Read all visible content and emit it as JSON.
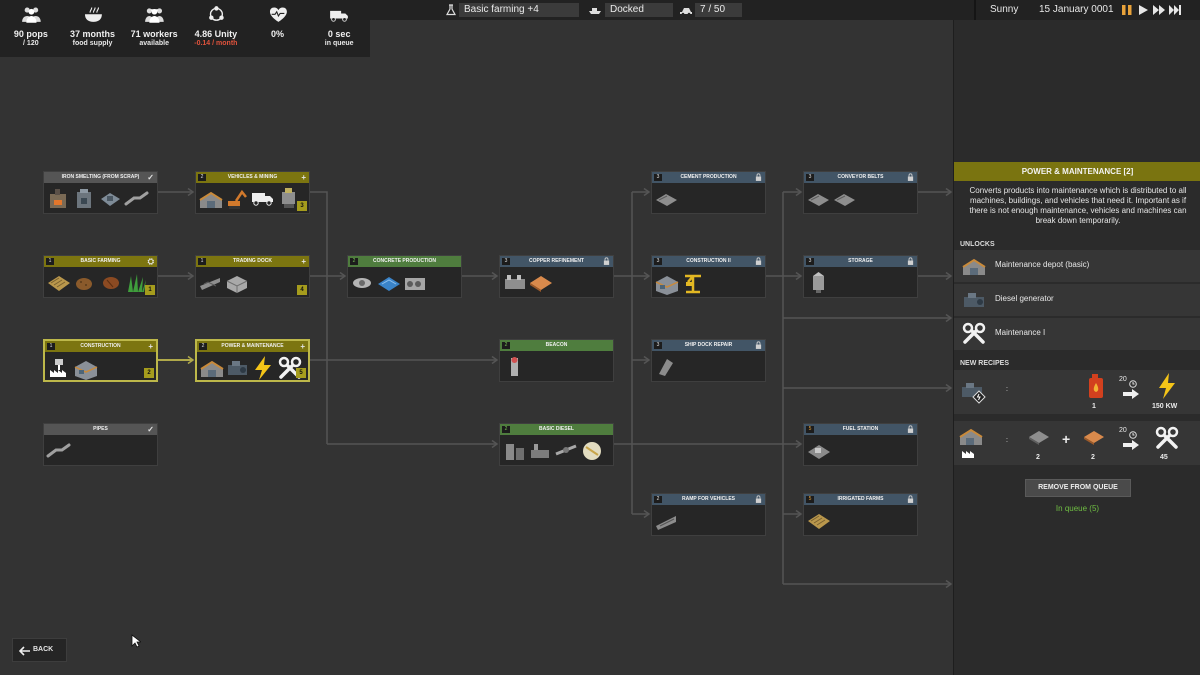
{
  "stats": [
    {
      "name": "pops",
      "icon": "people-icon",
      "value": "90 pops",
      "sub": "/ 120",
      "negative": false
    },
    {
      "name": "food",
      "icon": "bowl-icon",
      "value": "37 months",
      "sub": "food supply",
      "negative": false
    },
    {
      "name": "workers",
      "icon": "workers-icon",
      "value": "71 workers",
      "sub": "available",
      "negative": false
    },
    {
      "name": "unity",
      "icon": "unity-icon",
      "value": "4.86 Unity",
      "sub": "-0.14 / month",
      "negative": true
    },
    {
      "name": "health",
      "icon": "heart-icon",
      "value": "0%",
      "sub": "",
      "negative": false
    },
    {
      "name": "queue",
      "icon": "truck-icon",
      "value": "0 sec",
      "sub": "in queue",
      "negative": false
    }
  ],
  "topbar": {
    "research": "Basic farming +4",
    "ship_status": "Docked",
    "vehicles": "7 / 50",
    "weather": "Sunny",
    "date": "15 January 0001",
    "speed_controls": [
      "pause-icon",
      "play-icon",
      "fast-forward-icon",
      "fastest-icon"
    ]
  },
  "colors": {
    "header_yellow": "#7c7510",
    "header_green": "#4f7d3e",
    "header_blue": "#425566",
    "header_gray": "#555555",
    "queue_green": "#6fbf43",
    "negative_red": "#e0533c"
  },
  "tree": {
    "nodes": [
      {
        "id": "iron-smelting",
        "title": "IRON SMELTING (FROM SCRAP)",
        "tier": "",
        "color": "gray",
        "marker": "✓",
        "icons": [
          "furnace-icon",
          "smelter-icon",
          "machine-icon",
          "pipe-icon"
        ],
        "count": ""
      },
      {
        "id": "vehicles-mining",
        "title": "VEHICLES & MINING",
        "tier": "2",
        "color": "yellow",
        "marker": "+",
        "icons": [
          "depot-icon",
          "excavator-icon",
          "truck-icon",
          "robot-icon"
        ],
        "count": "3"
      },
      {
        "id": "basic-farming",
        "title": "BASIC FARMING",
        "tier": "1",
        "color": "yellow",
        "marker": "⛭",
        "icons": [
          "farm-field-icon",
          "potato-icon",
          "wheat-icon",
          "grass-icon"
        ],
        "count": "1"
      },
      {
        "id": "trading-dock",
        "title": "TRADING DOCK",
        "tier": "1",
        "color": "yellow",
        "marker": "+",
        "icons": [
          "dock-icon",
          "container-icon"
        ],
        "count": "4"
      },
      {
        "id": "construction",
        "title": "CONSTRUCTION",
        "tier": "1",
        "color": "yellow",
        "marker": "+",
        "icons": [
          "construction-hand-icon",
          "building-icon"
        ],
        "count": "2"
      },
      {
        "id": "power-maintenance",
        "title": "POWER & MAINTENANCE",
        "tier": "2",
        "color": "yellow",
        "marker": "+",
        "icons": [
          "depot-icon",
          "generator-icon",
          "lightning-icon",
          "wrench-icon"
        ],
        "count": "5"
      },
      {
        "id": "pipes",
        "title": "PIPES",
        "tier": "",
        "color": "gray",
        "marker": "✓",
        "icons": [
          "pipe-icon"
        ],
        "count": ""
      },
      {
        "id": "concrete-production",
        "title": "CONCRETE PRODUCTION",
        "tier": "2",
        "color": "green",
        "marker": "",
        "icons": [
          "mixer-icon",
          "concrete-slab-icon",
          "kiln-icon"
        ],
        "count": ""
      },
      {
        "id": "copper-refinement",
        "title": "COPPER REFINEMENT",
        "tier": "3",
        "color": "blue",
        "marker": "🔒",
        "icons": [
          "refinery-icon",
          "copper-plate-icon"
        ],
        "count": ""
      },
      {
        "id": "beacon",
        "title": "BEACON",
        "tier": "2",
        "color": "green",
        "marker": "",
        "icons": [
          "beacon-icon"
        ],
        "count": ""
      },
      {
        "id": "basic-diesel",
        "title": "BASIC DIESEL",
        "tier": "2",
        "color": "green",
        "marker": "",
        "icons": [
          "distiller-icon",
          "pump-icon",
          "pipeline-icon",
          "tank-icon"
        ],
        "count": ""
      },
      {
        "id": "cement-production",
        "title": "CEMENT PRODUCTION",
        "tier": "3",
        "color": "blue",
        "marker": "🔒",
        "icons": [
          "conveyor-icon"
        ],
        "count": ""
      },
      {
        "id": "construction-ii",
        "title": "CONSTRUCTION II",
        "tier": "3",
        "color": "blue",
        "marker": "🔒",
        "icons": [
          "building-icon",
          "crane-icon"
        ],
        "count": ""
      },
      {
        "id": "ship-dock-repair",
        "title": "SHIP DOCK REPAIR",
        "tier": "3",
        "color": "blue",
        "marker": "🔒",
        "icons": [
          "ship-part-icon"
        ],
        "count": ""
      },
      {
        "id": "ramp-for-vehicles",
        "title": "RAMP FOR VEHICLES",
        "tier": "2",
        "color": "blue",
        "marker": "🔒",
        "icons": [
          "ramp-icon"
        ],
        "count": ""
      },
      {
        "id": "conveyor-belts",
        "title": "CONVEYOR BELTS",
        "tier": "3",
        "color": "blue",
        "marker": "🔒",
        "icons": [
          "conveyor-icon",
          "conveyor-icon"
        ],
        "count": ""
      },
      {
        "id": "storage",
        "title": "STORAGE",
        "tier": "3",
        "color": "blue",
        "marker": "🔒",
        "icons": [
          "silo-icon"
        ],
        "count": ""
      },
      {
        "id": "fuel-station",
        "title": "FUEL STATION",
        "tier": "5",
        "color": "blue",
        "marker": "🔒",
        "icons": [
          "fuel-station-icon"
        ],
        "count": ""
      },
      {
        "id": "irrigated-farms",
        "title": "IRRIGATED FARMS",
        "tier": "5",
        "color": "blue",
        "marker": "🔒",
        "icons": [
          "farm-field-icon"
        ],
        "count": ""
      }
    ]
  },
  "panel": {
    "title": "POWER & MAINTENANCE [2]",
    "description": "Converts products into maintenance which is distributed to all machines, buildings, and vehicles that need it. Important as if there is not enough maintenance, vehicles and machines can break down temporarily.",
    "unlocks_label": "UNLOCKS",
    "unlocks": [
      {
        "icon": "depot-icon",
        "label": "Maintenance depot (basic)"
      },
      {
        "icon": "generator-icon",
        "label": "Diesel generator"
      },
      {
        "icon": "wrench-icon",
        "label": "Maintenance I"
      }
    ],
    "recipes_label": "NEW RECIPES",
    "recipes": [
      {
        "machine": "generator-icon",
        "inputs": [
          {
            "icon": "fuel-can-icon",
            "qty": "1"
          }
        ],
        "time": "20",
        "outputs": [
          {
            "icon": "lightning-icon",
            "qty": "150 KW"
          }
        ]
      },
      {
        "machine": "depot-icon",
        "inputs": [
          {
            "icon": "iron-plate-icon",
            "qty": "2"
          },
          {
            "icon": "copper-plate-icon",
            "qty": "2"
          }
        ],
        "time": "20",
        "outputs": [
          {
            "icon": "wrench-icon",
            "qty": "45"
          }
        ]
      }
    ],
    "remove_button": "REMOVE FROM QUEUE",
    "queue_status": "In queue (5)"
  },
  "back_button": "BACK"
}
